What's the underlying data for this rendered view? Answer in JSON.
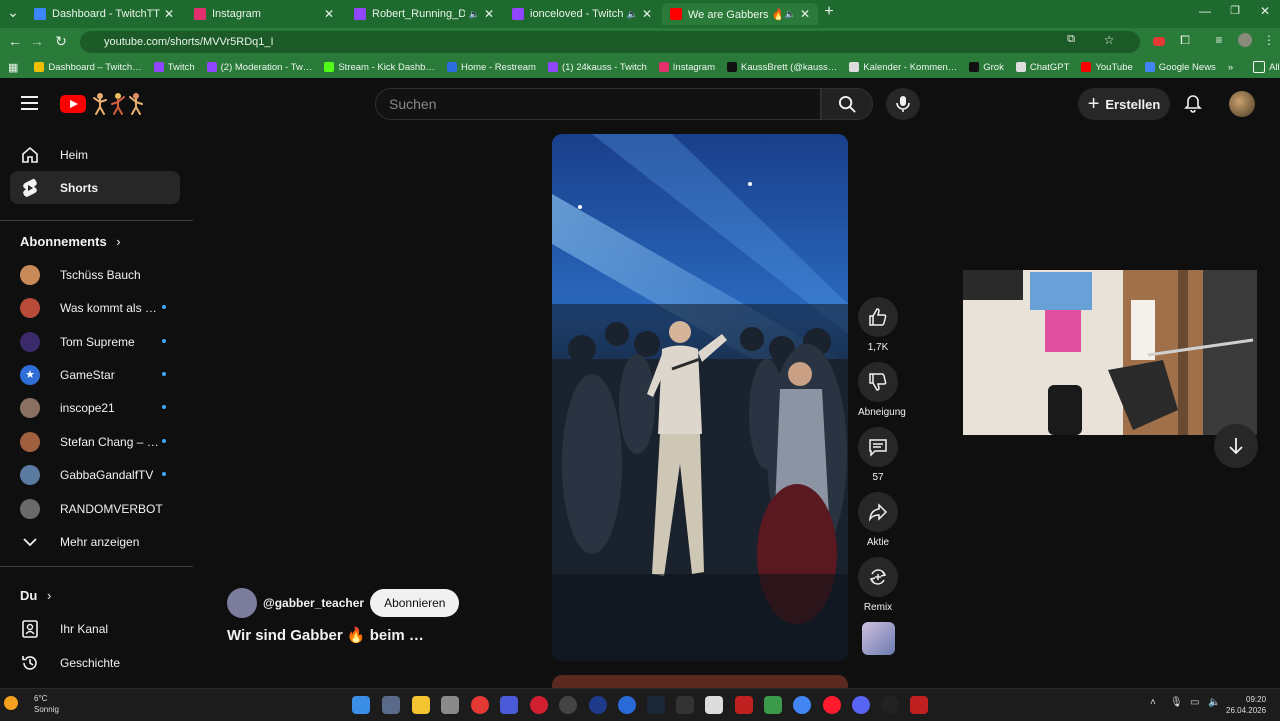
{
  "browser": {
    "tabs": [
      {
        "title": "Dashboard - TwitchTTS",
        "color": "#3a86ff"
      },
      {
        "title": "Instagram",
        "color": "#e1306c"
      },
      {
        "title": "Robert_Running_Dad - Twi…",
        "color": "#9146ff"
      },
      {
        "title": "ionceloved - Twitch",
        "color": "#9146ff"
      },
      {
        "title": "We are Gabbers 🔥 at the…",
        "color": "#ff0000"
      }
    ],
    "new_tab": "+",
    "url": "youtube.com/shorts/MVVr5RDq1_I",
    "bookmarks": [
      {
        "label": "Dashboard – Twitch…",
        "color": "#f0c000"
      },
      {
        "label": "Twitch",
        "color": "#9146ff"
      },
      {
        "label": "(2) Moderation - Tw…",
        "color": "#9146ff"
      },
      {
        "label": "Stream - Kick Dashb…",
        "color": "#53fc18"
      },
      {
        "label": "Home - Restream",
        "color": "#2d6cdf"
      },
      {
        "label": "(1) 24kauss - Twitch",
        "color": "#9146ff"
      },
      {
        "label": "Instagram",
        "color": "#e1306c"
      },
      {
        "label": "KaussBrett (@kauss…",
        "color": "#111111"
      },
      {
        "label": "Kalender - Kommen…",
        "color": "#dddddd"
      },
      {
        "label": "Grok",
        "color": "#111111"
      },
      {
        "label": "ChatGPT",
        "color": "#dddddd"
      },
      {
        "label": "YouTube",
        "color": "#ff0000"
      },
      {
        "label": "Google News",
        "color": "#4285f4"
      }
    ],
    "bookmarks_more": "»",
    "all_bookmarks": "Alle Lesezeichen"
  },
  "header": {
    "search_placeholder": "Suchen",
    "create_label": "Erstellen"
  },
  "sidebar": {
    "home": "Heim",
    "shorts": "Shorts",
    "subscriptions_heading": "Abonnements",
    "subscriptions": [
      {
        "name": "Tschüss Bauch",
        "dot": false,
        "color": "#c98a5a"
      },
      {
        "name": "Was kommt als …",
        "dot": true,
        "color": "#b84a3a"
      },
      {
        "name": "Tom Supreme",
        "dot": true,
        "color": "#3a2a6a"
      },
      {
        "name": "GameStar",
        "dot": true,
        "color": "#2f6ed6"
      },
      {
        "name": "inscope21",
        "dot": true,
        "color": "#8a7060"
      },
      {
        "name": "Stefan Chang – …",
        "dot": true,
        "color": "#a06040"
      },
      {
        "name": "GabbaGandalfTV",
        "dot": true,
        "color": "#5a7aa0"
      },
      {
        "name": "RANDOMVERBOT",
        "dot": false,
        "color": "#6a6a6a"
      }
    ],
    "show_more": "Mehr anzeigen",
    "you_heading": "Du",
    "your_channel": "Ihr Kanal",
    "history": "Geschichte"
  },
  "short": {
    "channel": "@gabber_teacher",
    "subscribe": "Abonnieren",
    "title": "Wir sind Gabber 🔥 beim …",
    "likes": "1,7K",
    "dislike": "Abneigung",
    "comments": "57",
    "share": "Aktie",
    "remix": "Remix"
  },
  "taskbar": {
    "temperature": "6°C",
    "weather": "Sonnig",
    "time": "09:20",
    "date": "26.04.2026"
  }
}
